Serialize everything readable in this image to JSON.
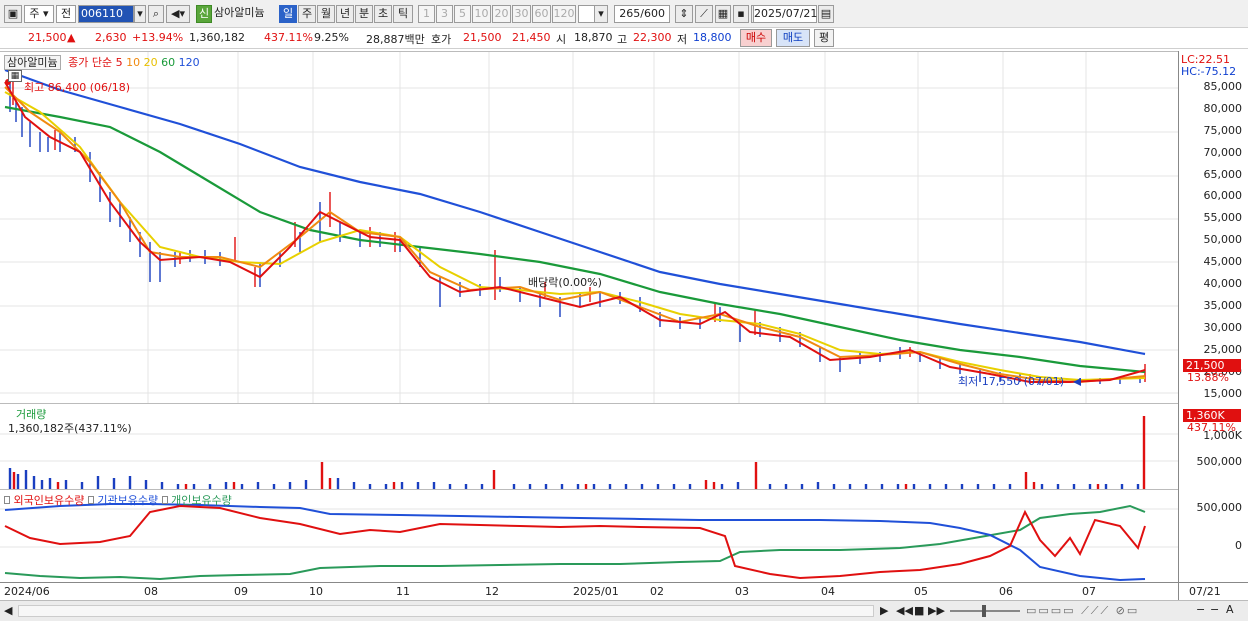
{
  "toolbar": {
    "market": "주",
    "prev": "전",
    "code": "006110",
    "badge": "신",
    "stock_name": "삼아알미늄",
    "periods": [
      "일",
      "주",
      "월",
      "년",
      "분",
      "초",
      "틱"
    ],
    "intervals": [
      "1",
      "3",
      "5",
      "10",
      "20",
      "30",
      "60",
      "120"
    ],
    "count": "265",
    "count_total": "/600",
    "date": "2025/07/21"
  },
  "info": {
    "price": "21,500",
    "change": "2,630",
    "change_pct": "+13.94%",
    "volume": "1,360,182",
    "volume_pct": "437.11%",
    "turnover": "9.25%",
    "amount": "28,887백만",
    "ask_label": "호가",
    "ask": "21,500",
    "bid": "21,450",
    "open_label": "시",
    "open": "18,870",
    "high_label": "고",
    "high": "22,300",
    "low_label": "저",
    "low": "18,800",
    "buy": "매수",
    "sell": "매도",
    "eval": "평"
  },
  "price_pane": {
    "name": "삼아알미늄",
    "ma_label": "종가 단순",
    "ma_periods": [
      "5",
      "10",
      "20",
      "60",
      "120"
    ],
    "ma_colors": [
      "#e01010",
      "#f08a10",
      "#e8d000",
      "#1a9a3a",
      "#2050d8"
    ],
    "high_note": "최고 86,400 (06/18)",
    "low_note": "최저 17,550 (07/01)",
    "dividend_note": "배당락(0.00%)",
    "lc": "LC:22.51",
    "hc": "HC:-75.12",
    "y_ticks": [
      "85,000",
      "80,000",
      "75,000",
      "70,000",
      "65,000",
      "60,000",
      "55,000",
      "50,000",
      "45,000",
      "40,000",
      "35,000",
      "30,000",
      "25,000",
      "20,000",
      "15,000"
    ],
    "last_price": "21,500",
    "last_pct": "13.88%"
  },
  "volume_pane": {
    "title": "거래량",
    "value": "1,360,182주(437.11%)",
    "y_ticks": [
      "1,000K",
      "500,000"
    ],
    "last_value": "1,360K",
    "last_pct": "437.11%"
  },
  "holdings_pane": {
    "legend": [
      "외국인보유수량",
      "기관보유수량",
      "개인보유수량"
    ],
    "colors": [
      "#e01010",
      "#2050d8",
      "#2a9a5a"
    ],
    "y_ticks": [
      "500,000",
      "0"
    ]
  },
  "x_axis": {
    "labels": [
      "2024/06",
      "08",
      "09",
      "10",
      "11",
      "12",
      "2025/01",
      "02",
      "03",
      "04",
      "05",
      "06",
      "07"
    ],
    "current": "07/21"
  },
  "chart_data": {
    "type": "line",
    "series": [
      {
        "name": "5",
        "values": [
          86400,
          72000,
          45000,
          44000,
          58000,
          47000,
          38000,
          35000,
          31000,
          28000,
          22000,
          24000,
          19000,
          18000,
          21500
        ]
      },
      {
        "name": "120",
        "values": [
          90000,
          85000,
          75000,
          65000,
          58000,
          52000,
          46000,
          42000,
          39000,
          37000,
          33000,
          30000,
          27000,
          25500,
          24500
        ]
      }
    ]
  }
}
